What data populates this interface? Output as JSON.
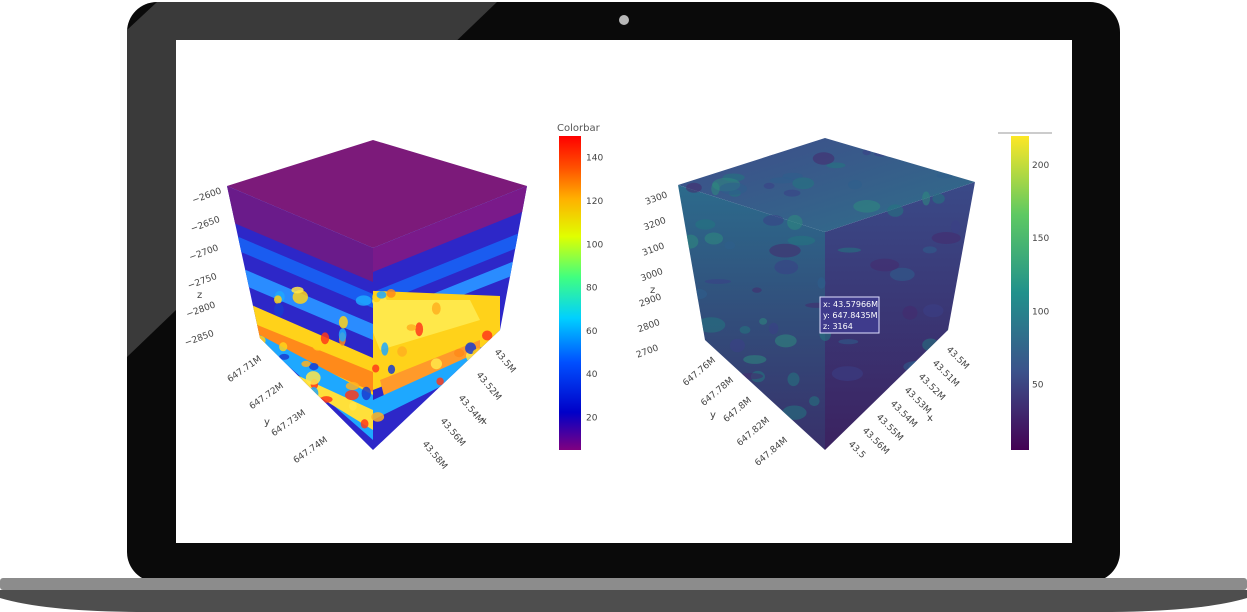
{
  "laptop": {
    "bezel_color": "#0a0a0a",
    "glare_color": "#3a3a3a",
    "screen_color": "#ffffff",
    "base_color": "#8c8c8c"
  },
  "chart_data": [
    {
      "type": "scatter3d",
      "colorscale": "jet",
      "colorbar": {
        "title": "Colorbar",
        "ticks": [
          140,
          120,
          100,
          80,
          60,
          40,
          20
        ],
        "range": [
          5,
          150
        ]
      },
      "z_axis": {
        "label": "z",
        "ticks": [
          "−2600",
          "−2650",
          "−2700",
          "−2750",
          "−2800",
          "−2850"
        ],
        "range": [
          -2880,
          -2590
        ]
      },
      "y_axis": {
        "label": "y",
        "ticks": [
          "647.71M",
          "647.72M",
          "647.73M",
          "647.74M"
        ]
      },
      "x_axis": {
        "label": "x",
        "ticks": [
          "43.5M",
          "43.52M",
          "43.54M",
          "43.56M",
          "43.58M"
        ]
      }
    },
    {
      "type": "volume",
      "colorscale": "viridis",
      "colorbar": {
        "title": "",
        "ticks": [
          200,
          150,
          100,
          50
        ],
        "range": [
          5,
          220
        ]
      },
      "z_axis": {
        "label": "z",
        "ticks": [
          "3300",
          "3200",
          "3100",
          "3000",
          "2900",
          "2800",
          "2700"
        ],
        "range": [
          2680,
          3320
        ]
      },
      "y_axis": {
        "label": "y",
        "ticks": [
          "647.76M",
          "647.78M",
          "647.8M",
          "647.82M",
          "647.84M"
        ]
      },
      "x_axis": {
        "label": "x",
        "ticks": [
          "43.5M",
          "43.51M",
          "43.52M",
          "43.53M",
          "43.54M",
          "43.55M",
          "43.56M",
          "43.5"
        ]
      },
      "hover": {
        "x": "x: 43.57966M",
        "y": "y: 647.8435M",
        "z": "z: 3164"
      }
    }
  ]
}
